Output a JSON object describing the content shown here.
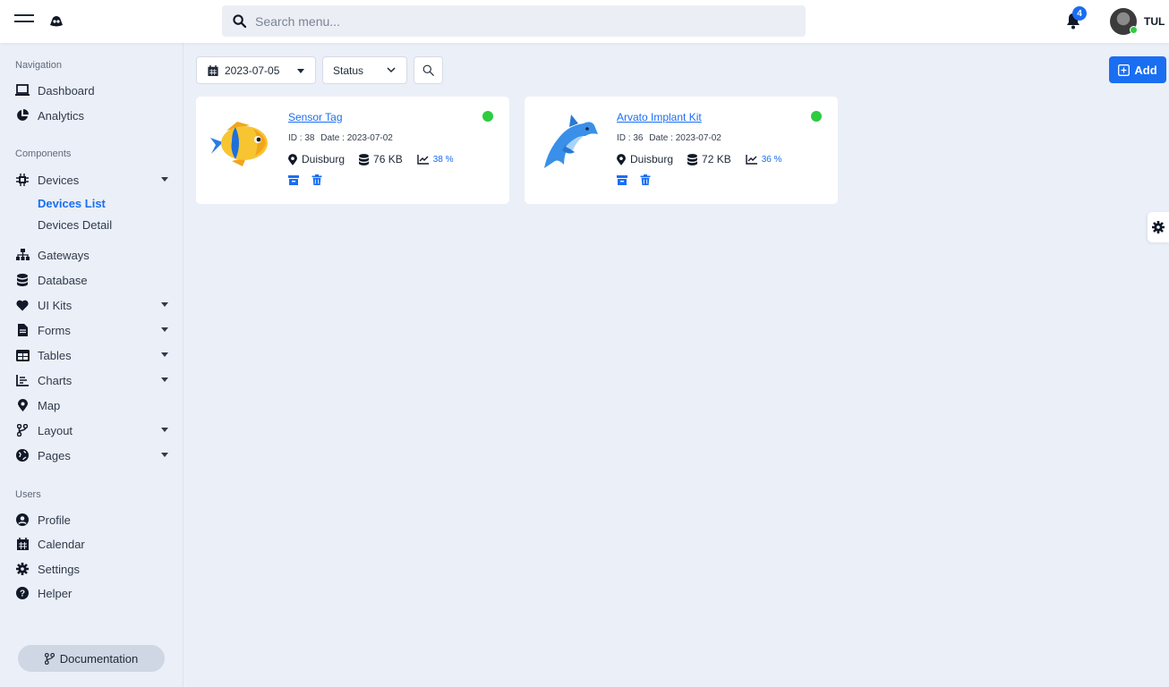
{
  "header": {
    "search_placeholder": "Search menu...",
    "notification_count": "4",
    "user_initials": "TUL"
  },
  "sidebar": {
    "sections": [
      {
        "title": "Navigation"
      },
      {
        "title": "Components"
      },
      {
        "title": "Users"
      }
    ],
    "navigation": [
      {
        "label": "Dashboard",
        "icon": "laptop-icon"
      },
      {
        "label": "Analytics",
        "icon": "pie-chart-icon"
      }
    ],
    "components": [
      {
        "label": "Devices",
        "icon": "chip-icon",
        "expandable": true
      },
      {
        "label": "Gateways",
        "icon": "sitemap-icon",
        "expandable": false
      },
      {
        "label": "Database",
        "icon": "database-icon",
        "expandable": false
      },
      {
        "label": "UI Kits",
        "icon": "heart-icon",
        "expandable": true
      },
      {
        "label": "Forms",
        "icon": "file-icon",
        "expandable": true
      },
      {
        "label": "Tables",
        "icon": "table-icon",
        "expandable": true
      },
      {
        "label": "Charts",
        "icon": "chart-icon",
        "expandable": true
      },
      {
        "label": "Map",
        "icon": "map-pin-icon",
        "expandable": false
      },
      {
        "label": "Layout",
        "icon": "branch-icon",
        "expandable": true
      },
      {
        "label": "Pages",
        "icon": "globe-icon",
        "expandable": true
      }
    ],
    "devices_sub": [
      {
        "label": "Devices List",
        "active": true
      },
      {
        "label": "Devices Detail",
        "active": false
      }
    ],
    "users": [
      {
        "label": "Profile",
        "icon": "user-circle-icon"
      },
      {
        "label": "Calendar",
        "icon": "calendar-icon"
      },
      {
        "label": "Settings",
        "icon": "gear-icon"
      },
      {
        "label": "Helper",
        "icon": "question-icon"
      }
    ],
    "documentation_label": "Documentation"
  },
  "toolbar": {
    "date_value": "2023-07-05",
    "status_label": "Status",
    "add_label": "Add"
  },
  "devices": [
    {
      "name": "Sensor Tag",
      "id_text": "ID : 38",
      "date_text": "Date : 2023-07-02",
      "location": "Duisburg",
      "size": "76 KB",
      "percent": "38 %",
      "status_color": "#2ecc40",
      "image": "tropical-fish"
    },
    {
      "name": "Arvato Implant Kit",
      "id_text": "ID : 36",
      "date_text": "Date : 2023-07-02",
      "location": "Duisburg",
      "size": "72 KB",
      "percent": "36 %",
      "status_color": "#2ecc40",
      "image": "dolphin"
    }
  ],
  "colors": {
    "accent": "#1a6ef2",
    "online": "#2ecc40",
    "background": "#ebeff8"
  }
}
